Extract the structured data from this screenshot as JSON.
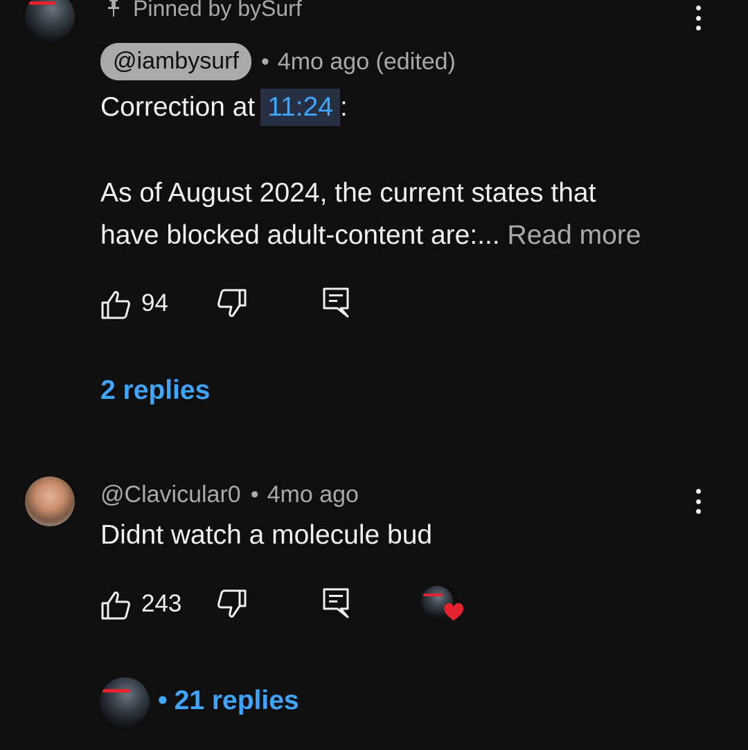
{
  "pinned_comment": {
    "pinned_label": "Pinned by bySurf",
    "handle": "@iambysurf",
    "time": "4mo ago (edited)",
    "line1_prefix": "Correction at",
    "timestamp": "11:24",
    "line1_suffix": ":",
    "body_line1": "As of August 2024, the current states that",
    "body_line2": "have blocked adult-content are:...",
    "read_more": "Read more",
    "likes": "94",
    "replies_label": "2 replies"
  },
  "second_comment": {
    "handle": "@Clavicular0",
    "time": "4mo ago",
    "text": "Didnt watch a molecule bud",
    "likes": "243",
    "replies_label": "21 replies"
  },
  "separator": "•",
  "colors": {
    "background": "#0f0f0f",
    "link_blue": "#3ea6ff",
    "secondary_text": "#aaaaaa",
    "heart_red": "#e5232f"
  },
  "icons": {
    "pin": "pin-icon",
    "like": "thumbs-up-icon",
    "dislike": "thumbs-down-icon",
    "reply": "reply-icon",
    "menu": "more-vert-icon",
    "heart": "heart-icon"
  }
}
